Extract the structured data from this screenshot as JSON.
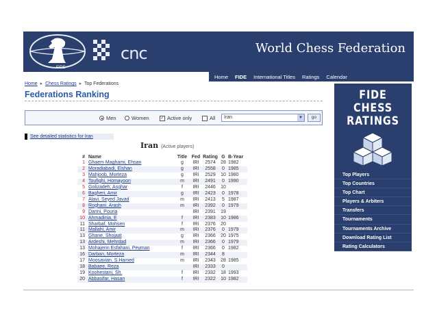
{
  "header": {
    "site_title": "World Chess Federation",
    "fide_logo_text": "FIDE",
    "cnc_logo_text": "cnc"
  },
  "nav": {
    "items": [
      "Home",
      "FIDE",
      "International Titles",
      "Ratings",
      "Calendar"
    ]
  },
  "breadcrumb": {
    "items": [
      "Home",
      "Chess Ratings",
      "Top Federations"
    ]
  },
  "page": {
    "heading": "Federations Ranking",
    "filter": {
      "men_label": "Men",
      "women_label": "Women",
      "active_only_label": "Active only",
      "all_label": "All",
      "selected_country": "Iran",
      "go_label": "go",
      "selected_gender": "Men",
      "active_only_checked": true
    },
    "stats_link": "See detailed statistics for Iran",
    "country_title": "Iran",
    "country_subtitle": "(Active players)"
  },
  "table": {
    "headers": [
      "#",
      "Name",
      "Title",
      "Fed",
      "Rating",
      "G",
      "B-Year"
    ],
    "rows": [
      {
        "no": "1",
        "name": "Ghaem Maghami, Ehsan",
        "title": "g",
        "fed": "IRI",
        "rating": "2574",
        "g": "28",
        "year": "1982"
      },
      {
        "no": "2",
        "name": "Moradiabadi, Elshan",
        "title": "g",
        "fed": "IRI",
        "rating": "2558",
        "g": "0",
        "year": "1985"
      },
      {
        "no": "3",
        "name": "Mahjoob, Morteza",
        "title": "g",
        "fed": "IRI",
        "rating": "2529",
        "g": "10",
        "year": "1980"
      },
      {
        "no": "4",
        "name": "Toufighi, Homayoon",
        "title": "m",
        "fed": "IRI",
        "rating": "2491",
        "g": "0",
        "year": "1990"
      },
      {
        "no": "5",
        "name": "Golizadeh, Asghar",
        "title": "f",
        "fed": "IRI",
        "rating": "2446",
        "g": "10",
        "year": ""
      },
      {
        "no": "6",
        "name": "Bagheri, Amir",
        "title": "g",
        "fed": "IRI",
        "rating": "2423",
        "g": "0",
        "year": "1978"
      },
      {
        "no": "7",
        "name": "Alavi, Seyed Javad",
        "title": "m",
        "fed": "IRI",
        "rating": "2413",
        "g": "5",
        "year": "1987"
      },
      {
        "no": "8",
        "name": "Roghani, Arash",
        "title": "m",
        "fed": "IRI",
        "rating": "2392",
        "g": "0",
        "year": "1979"
      },
      {
        "no": "9",
        "name": "Darini, Pouria",
        "title": "",
        "fed": "IRI",
        "rating": "2391",
        "g": "19",
        "year": ""
      },
      {
        "no": "10",
        "name": "Ahmadinia, E",
        "title": "f",
        "fed": "IRI",
        "rating": "2383",
        "g": "10",
        "year": "1986"
      },
      {
        "no": "11",
        "name": "Sharbaf, Mohsen",
        "title": "f",
        "fed": "IRI",
        "rating": "2376",
        "g": "20",
        "year": ""
      },
      {
        "no": "11",
        "name": "Mallahi, Amir",
        "title": "m",
        "fed": "IRI",
        "rating": "2376",
        "g": "0",
        "year": "1979"
      },
      {
        "no": "13",
        "name": "Ghane, Shojaat",
        "title": "g",
        "fed": "IRI",
        "rating": "2366",
        "g": "20",
        "year": "1975"
      },
      {
        "no": "13",
        "name": "Ardeshi, Mehrdad",
        "title": "m",
        "fed": "IRI",
        "rating": "2366",
        "g": "0",
        "year": "1979"
      },
      {
        "no": "13",
        "name": "Mohajerin Esfahani, Peyman",
        "title": "f",
        "fed": "IRI",
        "rating": "2366",
        "g": "0",
        "year": "1982"
      },
      {
        "no": "16",
        "name": "Darban, Morteza",
        "title": "m",
        "fed": "IRI",
        "rating": "2344",
        "g": "8",
        "year": ""
      },
      {
        "no": "17",
        "name": "Moosavian, S.Hamed",
        "title": "m",
        "fed": "IRI",
        "rating": "2343",
        "g": "28",
        "year": "1985"
      },
      {
        "no": "18",
        "name": "Babaee, Reza",
        "title": "",
        "fed": "IRI",
        "rating": "2333",
        "g": "0",
        "year": ""
      },
      {
        "no": "19",
        "name": "Koohestani, Sh.",
        "title": "f",
        "fed": "IRI",
        "rating": "2332",
        "g": "18",
        "year": "1993"
      },
      {
        "no": "20",
        "name": "Abbasifar, Hasan",
        "title": "f",
        "fed": "IRI",
        "rating": "2322",
        "g": "10",
        "year": "1982"
      }
    ]
  },
  "sidebar": {
    "logo_lines": [
      "FIDE",
      "CHESS",
      "RATINGS"
    ],
    "menu": [
      "Top Players",
      "Top Countries",
      "Top Chart",
      "Players & Arbiters",
      "Transfers",
      "Tournaments",
      "Tournaments Archive",
      "Download Rating List",
      "Rating Calculators"
    ]
  },
  "colors": {
    "navy": "#2b3f6e",
    "link": "#1b3a8a",
    "heading_blue": "#2b5aa8",
    "rank_red": "#d22"
  }
}
